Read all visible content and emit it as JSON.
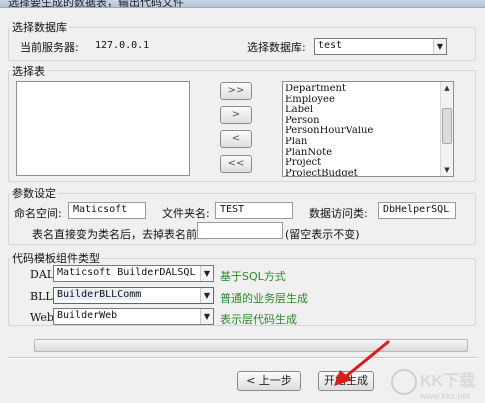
{
  "window": {
    "title": "选择要生成的数据表，输出代码文件"
  },
  "db_section": {
    "label": "选择数据库",
    "server_label": "当前服务器:",
    "server_value": "127.0.0.1",
    "db_label": "选择数据库:",
    "db_value": "test"
  },
  "table_section": {
    "label": "选择表",
    "move_buttons": [
      ">>",
      ">",
      "<",
      "<<"
    ],
    "tables": [
      "Department",
      "Employee",
      "Label",
      "Person",
      "PersonHourValue",
      "Plan",
      "PlanNote",
      "Project",
      "ProjectBudget"
    ]
  },
  "params": {
    "label": "参数设定",
    "namespace_label": "命名空间:",
    "namespace_value": "Maticsoft",
    "folder_label": "文件夹名:",
    "folder_value": "TEST",
    "dal_label": "数据访问类:",
    "dal_value": "DbHelperSQL",
    "prefix_label": "表名直接变为类名后，去掉表名前缀:",
    "prefix_value": "",
    "prefix_hint": "(留空表示不变)"
  },
  "templates": {
    "label": "代码模板组件类型",
    "rows": [
      {
        "name": "DAL",
        "value": "Maticsoft BuilderDALSQL",
        "desc": "基于SQL方式"
      },
      {
        "name": "BLL",
        "value": "BuilderBLLComm",
        "desc": "普通的业务层生成"
      },
      {
        "name": "Web",
        "value": "BuilderWeb",
        "desc": "表示层代码生成"
      }
    ]
  },
  "buttons": {
    "back": "< 上一步",
    "start": "开始生成"
  },
  "watermark": {
    "text": "KK下载",
    "url": "www.kkx.net"
  },
  "colors": {
    "desc_text": "#2a8a2a",
    "annotation_arrow": "#e01818",
    "window_bg": "#f0f0f0"
  },
  "icons": {
    "dropdown": "chevron-down-icon",
    "annotation": "red-arrow-icon"
  }
}
